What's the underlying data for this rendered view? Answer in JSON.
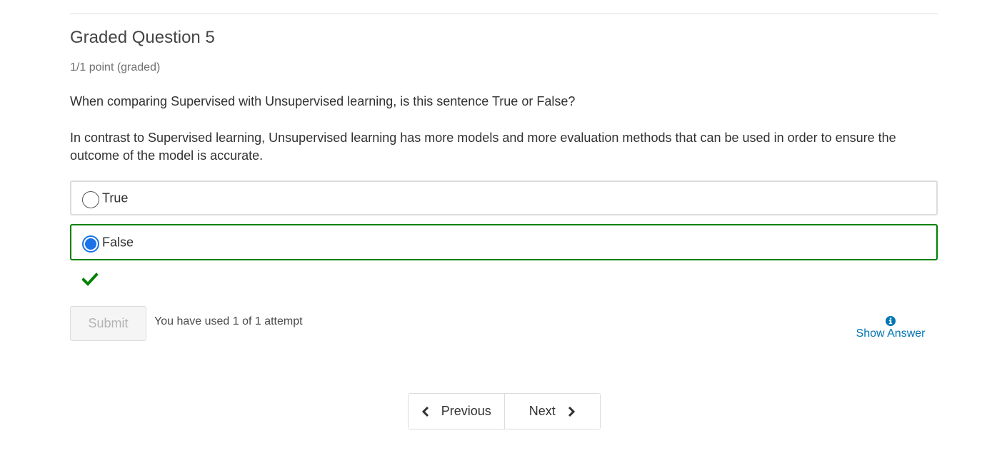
{
  "problem": {
    "title": "Graded Question 5",
    "points": "1/1 point (graded)",
    "prompt": "When comparing Supervised with Unsupervised learning, is this sentence True or False?",
    "statement": "In contrast to Supervised learning, Unsupervised learning has more models and more evaluation methods that can be used in order to ensure the outcome of the model is accurate.",
    "options": [
      {
        "label": "True",
        "selected": false
      },
      {
        "label": "False",
        "selected": true
      }
    ],
    "status": "correct"
  },
  "actions": {
    "submit_label": "Submit",
    "attempts_text": "You have used 1 of 1 attempt",
    "show_answer_label": "Show Answer"
  },
  "navigation": {
    "previous_label": "Previous",
    "next_label": "Next"
  },
  "colors": {
    "correct": "#008100",
    "link": "#0075b4",
    "radio_selected": "#1a73e8"
  }
}
